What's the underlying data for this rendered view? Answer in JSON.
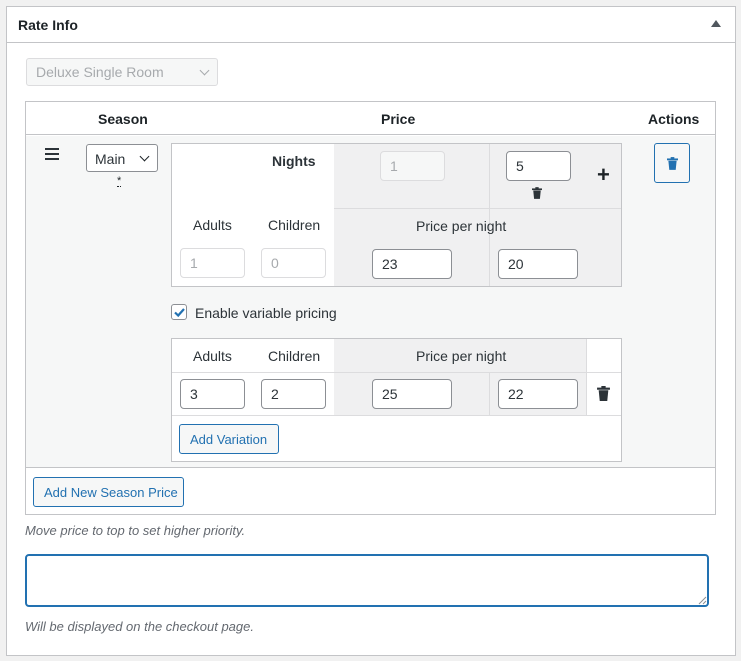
{
  "metabox": {
    "title": "Rate Info"
  },
  "room_select": {
    "value": "Deluxe Single Room"
  },
  "table": {
    "headers": {
      "season": "Season",
      "price": "Price",
      "actions": "Actions"
    }
  },
  "season": {
    "select_value": "Main Season",
    "required_marker": "*",
    "nights_label": "Nights",
    "nights_from": "1",
    "nights_to": "5",
    "adults_label": "Adults",
    "children_label": "Children",
    "price_per_night_label": "Price per night",
    "adults_value": "1",
    "children_value": "0",
    "price_1": "23",
    "price_2": "20",
    "enable_variable_pricing_label": "Enable variable pricing",
    "enable_variable_pricing_checked": true
  },
  "variation": {
    "adults_label": "Adults",
    "children_label": "Children",
    "price_per_night_label": "Price per night",
    "adults_value": "3",
    "children_value": "2",
    "price_1": "25",
    "price_2": "22",
    "add_variation_label": "Add Variation"
  },
  "add_season_price_label": "Add New Season Price",
  "priority_hint": "Move price to top to set higher priority.",
  "description_value": "",
  "checkout_hint": "Will be displayed on the checkout page.",
  "colors": {
    "accent": "#2271b1",
    "border": "#c3c4c7",
    "shade": "#f0f0f1"
  }
}
